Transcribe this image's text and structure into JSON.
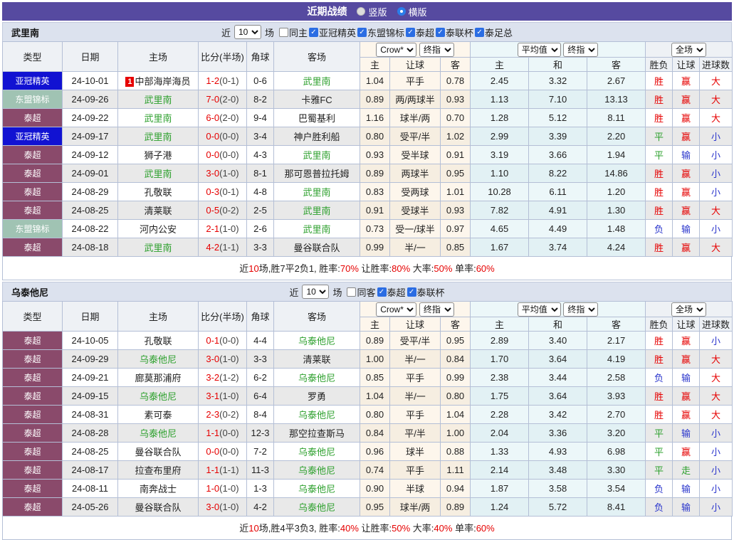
{
  "titlebar": {
    "title": "近期战绩",
    "vertical_label": "竖版",
    "horizontal_label": "横版"
  },
  "selects": {
    "bookmaker": "Crow*",
    "final": "终指",
    "average": "平均值",
    "fulltime": "全场"
  },
  "cols": {
    "type": "类型",
    "date": "日期",
    "home": "主场",
    "score": "比分(半场)",
    "corner": "角球",
    "away": "客场",
    "h_home": "主",
    "h_hcp": "让球",
    "h_away": "客",
    "a_home": "主",
    "a_draw": "和",
    "a_away": "客",
    "r_wdl": "胜负",
    "r_hcp": "让球",
    "r_goals": "进球数"
  },
  "colors": {
    "accent_purple": "#564aa0",
    "red": "#e60000",
    "green": "#2da02d",
    "blue": "#2a35cc",
    "league_acl_blue": "#1112d2",
    "league_asean_sage": "#a0c3b3",
    "league_thai_plum": "#8a4a6b",
    "checkbox_blue": "#2b6de3",
    "handicap_col_bg": "#fdf6ec",
    "average_col_bg": "#ecf7f9"
  },
  "sections": [
    {
      "team": "武里南",
      "filter": {
        "prefix": "近",
        "count": "10",
        "suffix": "场",
        "checkboxes": [
          {
            "label": "同主",
            "checked": false
          },
          {
            "label": "亚冠精英",
            "checked": true
          },
          {
            "label": "东盟锦标",
            "checked": true
          },
          {
            "label": "泰超",
            "checked": true
          },
          {
            "label": "泰联杯",
            "checked": true
          },
          {
            "label": "泰足总",
            "checked": true
          }
        ]
      },
      "rows": [
        {
          "league": "亚冠精英",
          "lstyle": "acl",
          "date": "24-10-01",
          "rank": "1",
          "home": "中部海岸海员",
          "home_focus": false,
          "score": "1-2",
          "half": "(0-1)",
          "corner": "0-6",
          "away": "武里南",
          "away_focus": true,
          "hcp": [
            "1.04",
            "平手",
            "0.78"
          ],
          "avg": [
            "2.45",
            "3.32",
            "2.67"
          ],
          "res": [
            [
              "胜",
              "red"
            ],
            [
              "赢",
              "red"
            ],
            [
              "大",
              "red"
            ]
          ]
        },
        {
          "league": "东盟锦标",
          "lstyle": "asean",
          "date": "24-09-26",
          "home": "武里南",
          "home_focus": true,
          "score": "7-0",
          "half": "(2-0)",
          "corner": "8-2",
          "away": "卡雅FC",
          "away_focus": false,
          "hcp": [
            "0.89",
            "两/两球半",
            "0.93"
          ],
          "avg": [
            "1.13",
            "7.10",
            "13.13"
          ],
          "res": [
            [
              "胜",
              "red"
            ],
            [
              "赢",
              "red"
            ],
            [
              "大",
              "red"
            ]
          ]
        },
        {
          "league": "泰超",
          "lstyle": "thai",
          "date": "24-09-22",
          "home": "武里南",
          "home_focus": true,
          "score": "6-0",
          "half": "(2-0)",
          "corner": "9-4",
          "away": "巴蜀基利",
          "away_focus": false,
          "hcp": [
            "1.16",
            "球半/两",
            "0.70"
          ],
          "avg": [
            "1.28",
            "5.12",
            "8.11"
          ],
          "res": [
            [
              "胜",
              "red"
            ],
            [
              "赢",
              "red"
            ],
            [
              "大",
              "red"
            ]
          ]
        },
        {
          "league": "亚冠精英",
          "lstyle": "acl",
          "date": "24-09-17",
          "home": "武里南",
          "home_focus": true,
          "score": "0-0",
          "half": "(0-0)",
          "corner": "3-4",
          "away": "神户胜利船",
          "away_focus": false,
          "hcp": [
            "0.80",
            "受平/半",
            "1.02"
          ],
          "avg": [
            "2.99",
            "3.39",
            "2.20"
          ],
          "res": [
            [
              "平",
              "green"
            ],
            [
              "赢",
              "red"
            ],
            [
              "小",
              "blue"
            ]
          ]
        },
        {
          "league": "泰超",
          "lstyle": "thai",
          "date": "24-09-12",
          "home": "狮子港",
          "home_focus": false,
          "score": "0-0",
          "half": "(0-0)",
          "corner": "4-3",
          "away": "武里南",
          "away_focus": true,
          "hcp": [
            "0.93",
            "受半球",
            "0.91"
          ],
          "avg": [
            "3.19",
            "3.66",
            "1.94"
          ],
          "res": [
            [
              "平",
              "green"
            ],
            [
              "输",
              "blue"
            ],
            [
              "小",
              "blue"
            ]
          ]
        },
        {
          "league": "泰超",
          "lstyle": "thai",
          "date": "24-09-01",
          "home": "武里南",
          "home_focus": true,
          "score": "3-0",
          "half": "(1-0)",
          "corner": "8-1",
          "away": "那可恩普拉托姆",
          "away_focus": false,
          "hcp": [
            "0.89",
            "两球半",
            "0.95"
          ],
          "avg": [
            "1.10",
            "8.22",
            "14.86"
          ],
          "res": [
            [
              "胜",
              "red"
            ],
            [
              "赢",
              "red"
            ],
            [
              "小",
              "blue"
            ]
          ]
        },
        {
          "league": "泰超",
          "lstyle": "thai",
          "date": "24-08-29",
          "home": "孔敬联",
          "home_focus": false,
          "score": "0-3",
          "half": "(0-1)",
          "corner": "4-8",
          "away": "武里南",
          "away_focus": true,
          "hcp": [
            "0.83",
            "受两球",
            "1.01"
          ],
          "avg": [
            "10.28",
            "6.11",
            "1.20"
          ],
          "res": [
            [
              "胜",
              "red"
            ],
            [
              "赢",
              "red"
            ],
            [
              "小",
              "blue"
            ]
          ]
        },
        {
          "league": "泰超",
          "lstyle": "thai",
          "date": "24-08-25",
          "home": "清莱联",
          "home_focus": false,
          "score": "0-5",
          "half": "(0-2)",
          "corner": "2-5",
          "away": "武里南",
          "away_focus": true,
          "hcp": [
            "0.91",
            "受球半",
            "0.93"
          ],
          "avg": [
            "7.82",
            "4.91",
            "1.30"
          ],
          "res": [
            [
              "胜",
              "red"
            ],
            [
              "赢",
              "red"
            ],
            [
              "大",
              "red"
            ]
          ]
        },
        {
          "league": "东盟锦标",
          "lstyle": "asean",
          "date": "24-08-22",
          "home": "河内公安",
          "home_focus": false,
          "score": "2-1",
          "half": "(1-0)",
          "corner": "2-6",
          "away": "武里南",
          "away_focus": true,
          "hcp": [
            "0.73",
            "受一/球半",
            "0.97"
          ],
          "avg": [
            "4.65",
            "4.49",
            "1.48"
          ],
          "res": [
            [
              "负",
              "blue"
            ],
            [
              "输",
              "blue"
            ],
            [
              "小",
              "blue"
            ]
          ]
        },
        {
          "league": "泰超",
          "lstyle": "thai",
          "date": "24-08-18",
          "home": "武里南",
          "home_focus": true,
          "score": "4-2",
          "half": "(1-1)",
          "corner": "3-3",
          "away": "曼谷联合队",
          "away_focus": false,
          "hcp": [
            "0.99",
            "半/一",
            "0.85"
          ],
          "avg": [
            "1.67",
            "3.74",
            "4.24"
          ],
          "res": [
            [
              "胜",
              "red"
            ],
            [
              "赢",
              "red"
            ],
            [
              "大",
              "red"
            ]
          ]
        }
      ],
      "summary": [
        {
          "t": "近"
        },
        {
          "t": "10",
          "r": 1
        },
        {
          "t": "场,胜7平2负1, 胜率:"
        },
        {
          "t": "70%",
          "r": 1
        },
        {
          "t": " 让胜率:"
        },
        {
          "t": "80%",
          "r": 1
        },
        {
          "t": " 大率:"
        },
        {
          "t": "50%",
          "r": 1
        },
        {
          "t": " 单率:"
        },
        {
          "t": "60%",
          "r": 1
        }
      ]
    },
    {
      "team": "乌泰他尼",
      "filter": {
        "prefix": "近",
        "count": "10",
        "suffix": "场",
        "checkboxes": [
          {
            "label": "同客",
            "checked": false
          },
          {
            "label": "泰超",
            "checked": true
          },
          {
            "label": "泰联杯",
            "checked": true
          }
        ]
      },
      "rows": [
        {
          "league": "泰超",
          "lstyle": "thai",
          "date": "24-10-05",
          "home": "孔敬联",
          "home_focus": false,
          "score": "0-1",
          "half": "(0-0)",
          "corner": "4-4",
          "away": "乌泰他尼",
          "away_focus": true,
          "hcp": [
            "0.89",
            "受平/半",
            "0.95"
          ],
          "avg": [
            "2.89",
            "3.40",
            "2.17"
          ],
          "res": [
            [
              "胜",
              "red"
            ],
            [
              "赢",
              "red"
            ],
            [
              "小",
              "blue"
            ]
          ]
        },
        {
          "league": "泰超",
          "lstyle": "thai",
          "date": "24-09-29",
          "home": "乌泰他尼",
          "home_focus": true,
          "score": "3-0",
          "half": "(1-0)",
          "corner": "3-3",
          "away": "清莱联",
          "away_focus": false,
          "hcp": [
            "1.00",
            "半/一",
            "0.84"
          ],
          "avg": [
            "1.70",
            "3.64",
            "4.19"
          ],
          "res": [
            [
              "胜",
              "red"
            ],
            [
              "赢",
              "red"
            ],
            [
              "大",
              "red"
            ]
          ]
        },
        {
          "league": "泰超",
          "lstyle": "thai",
          "date": "24-09-21",
          "home": "廊莫那浦府",
          "home_focus": false,
          "score": "3-2",
          "half": "(1-2)",
          "corner": "6-2",
          "away": "乌泰他尼",
          "away_focus": true,
          "hcp": [
            "0.85",
            "平手",
            "0.99"
          ],
          "avg": [
            "2.38",
            "3.44",
            "2.58"
          ],
          "res": [
            [
              "负",
              "blue"
            ],
            [
              "输",
              "blue"
            ],
            [
              "大",
              "red"
            ]
          ]
        },
        {
          "league": "泰超",
          "lstyle": "thai",
          "date": "24-09-15",
          "home": "乌泰他尼",
          "home_focus": true,
          "score": "3-1",
          "half": "(1-0)",
          "corner": "6-4",
          "away": "罗勇",
          "away_focus": false,
          "hcp": [
            "1.04",
            "半/一",
            "0.80"
          ],
          "avg": [
            "1.75",
            "3.64",
            "3.93"
          ],
          "res": [
            [
              "胜",
              "red"
            ],
            [
              "赢",
              "red"
            ],
            [
              "大",
              "red"
            ]
          ]
        },
        {
          "league": "泰超",
          "lstyle": "thai",
          "date": "24-08-31",
          "home": "素可泰",
          "home_focus": false,
          "score": "2-3",
          "half": "(0-2)",
          "corner": "8-4",
          "away": "乌泰他尼",
          "away_focus": true,
          "hcp": [
            "0.80",
            "平手",
            "1.04"
          ],
          "avg": [
            "2.28",
            "3.42",
            "2.70"
          ],
          "res": [
            [
              "胜",
              "red"
            ],
            [
              "赢",
              "red"
            ],
            [
              "大",
              "red"
            ]
          ]
        },
        {
          "league": "泰超",
          "lstyle": "thai",
          "date": "24-08-28",
          "home": "乌泰他尼",
          "home_focus": true,
          "score": "1-1",
          "half": "(0-0)",
          "corner": "12-3",
          "away": "那空拉查斯马",
          "away_focus": false,
          "hcp": [
            "0.84",
            "平/半",
            "1.00"
          ],
          "avg": [
            "2.04",
            "3.36",
            "3.20"
          ],
          "res": [
            [
              "平",
              "green"
            ],
            [
              "输",
              "blue"
            ],
            [
              "小",
              "blue"
            ]
          ]
        },
        {
          "league": "泰超",
          "lstyle": "thai",
          "date": "24-08-25",
          "home": "曼谷联合队",
          "home_focus": false,
          "score": "0-0",
          "half": "(0-0)",
          "corner": "7-2",
          "away": "乌泰他尼",
          "away_focus": true,
          "hcp": [
            "0.96",
            "球半",
            "0.88"
          ],
          "avg": [
            "1.33",
            "4.93",
            "6.98"
          ],
          "res": [
            [
              "平",
              "green"
            ],
            [
              "赢",
              "red"
            ],
            [
              "小",
              "blue"
            ]
          ]
        },
        {
          "league": "泰超",
          "lstyle": "thai",
          "date": "24-08-17",
          "home": "拉查布里府",
          "home_focus": false,
          "score": "1-1",
          "half": "(1-1)",
          "corner": "11-3",
          "away": "乌泰他尼",
          "away_focus": true,
          "hcp": [
            "0.74",
            "平手",
            "1.11"
          ],
          "avg": [
            "2.14",
            "3.48",
            "3.30"
          ],
          "res": [
            [
              "平",
              "green"
            ],
            [
              "走",
              "green"
            ],
            [
              "小",
              "blue"
            ]
          ]
        },
        {
          "league": "泰超",
          "lstyle": "thai",
          "date": "24-08-11",
          "home": "南奔战士",
          "home_focus": false,
          "score": "1-0",
          "half": "(1-0)",
          "corner": "1-3",
          "away": "乌泰他尼",
          "away_focus": true,
          "hcp": [
            "0.90",
            "半球",
            "0.94"
          ],
          "avg": [
            "1.87",
            "3.58",
            "3.54"
          ],
          "res": [
            [
              "负",
              "blue"
            ],
            [
              "输",
              "blue"
            ],
            [
              "小",
              "blue"
            ]
          ]
        },
        {
          "league": "泰超",
          "lstyle": "thai",
          "date": "24-05-26",
          "home": "曼谷联合队",
          "home_focus": false,
          "score": "3-0",
          "half": "(1-0)",
          "corner": "4-2",
          "away": "乌泰他尼",
          "away_focus": true,
          "hcp": [
            "0.95",
            "球半/两",
            "0.89"
          ],
          "avg": [
            "1.24",
            "5.72",
            "8.41"
          ],
          "res": [
            [
              "负",
              "blue"
            ],
            [
              "输",
              "blue"
            ],
            [
              "小",
              "blue"
            ]
          ]
        }
      ],
      "summary": [
        {
          "t": "近"
        },
        {
          "t": "10",
          "r": 1
        },
        {
          "t": "场,胜4平3负3, 胜率:"
        },
        {
          "t": "40%",
          "r": 1
        },
        {
          "t": " 让胜率:"
        },
        {
          "t": "50%",
          "r": 1
        },
        {
          "t": " 大率:"
        },
        {
          "t": "40%",
          "r": 1
        },
        {
          "t": " 单率:"
        },
        {
          "t": "60%",
          "r": 1
        }
      ]
    }
  ]
}
